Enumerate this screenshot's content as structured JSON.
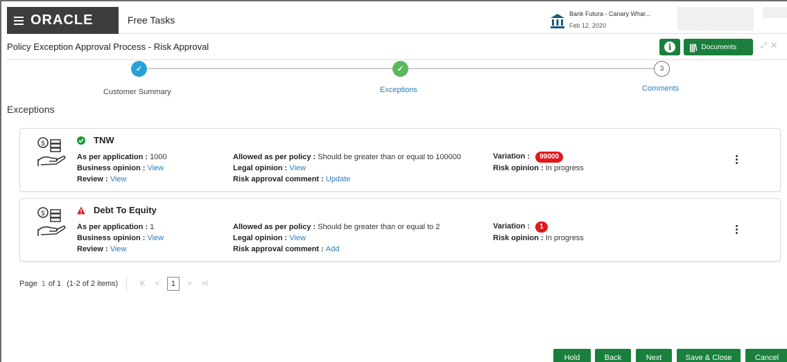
{
  "topbar": {
    "brand": "ORACLE",
    "app_title": "Free Tasks",
    "bank_name": "Bank Futura - Canary Whar...",
    "bank_date": "Feb 12, 2020"
  },
  "process": {
    "title": "Policy Exception Approval Process - Risk Approval",
    "documents_label": "Documents",
    "info_glyph": "i"
  },
  "steps": [
    {
      "label": "Customer Summary",
      "state": "done",
      "glyph": "✓"
    },
    {
      "label": "Exceptions",
      "state": "current",
      "glyph": "✓"
    },
    {
      "label": "Comments",
      "state": "pending",
      "glyph": "3"
    }
  ],
  "section_title": "Exceptions",
  "exceptions": [
    {
      "title": "TNW",
      "status": "ok",
      "as_per_application_label": "As per application : ",
      "as_per_application": "1000",
      "business_opinion_label": "Business opinion : ",
      "business_opinion_link": "View",
      "review_label": "Review : ",
      "review_link": "View",
      "allowed_label": "Allowed as per policy : ",
      "allowed": "Should be greater than or equal to 100000",
      "legal_opinion_label": "Legal opinion : ",
      "legal_opinion_link": "View",
      "risk_comment_label": "Risk approval comment : ",
      "risk_comment_link": "Update",
      "variation_label": "Variation : ",
      "variation": "99000",
      "risk_opinion_label": "Risk opinion : ",
      "risk_opinion": "In progress"
    },
    {
      "title": "Debt To Equity",
      "status": "warning",
      "as_per_application_label": "As per application : ",
      "as_per_application": "1",
      "business_opinion_label": "Business opinion : ",
      "business_opinion_link": "View",
      "review_label": "Review : ",
      "review_link": "View",
      "allowed_label": "Allowed as per policy : ",
      "allowed": "Should be greater than or equal to 2",
      "legal_opinion_label": "Legal opinion : ",
      "legal_opinion_link": "View",
      "risk_comment_label": "Risk approval comment : ",
      "risk_comment_link": "Add",
      "variation_label": "Variation : ",
      "variation": "1",
      "risk_opinion_label": "Risk opinion : ",
      "risk_opinion": "In progress"
    }
  ],
  "pager": {
    "page_label": "Page",
    "page_current": "1",
    "of_label": "of 1",
    "items_label": "(1-2 of 2 items)",
    "first": "K",
    "prev": "<",
    "page_box": "1",
    "next": ">",
    "last": ">I"
  },
  "footer": {
    "hold": "Hold",
    "back": "Back",
    "next": "Next",
    "save_close": "Save & Close",
    "cancel": "Cancel"
  },
  "colors": {
    "accent_green": "#1a7f3c",
    "step_done": "#2aa0d8",
    "step_current": "#5cb85c",
    "badge_red": "#e3181b",
    "link_blue": "#2b7bb9"
  }
}
